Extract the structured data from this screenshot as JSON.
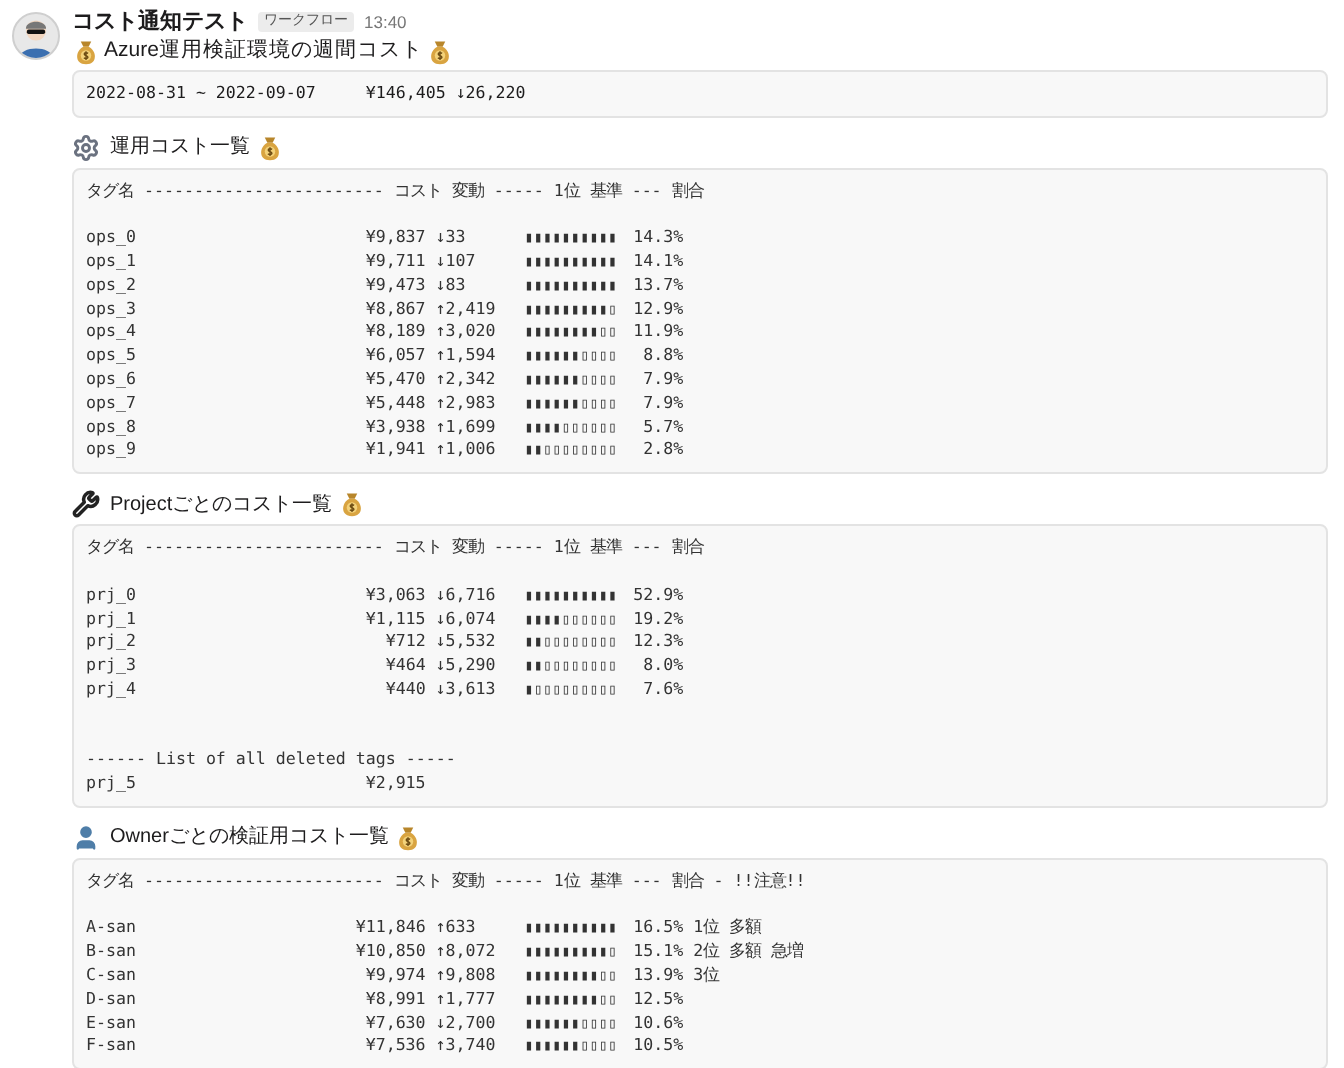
{
  "message": {
    "sender": "コスト通知テスト",
    "badge": "ワークフロー",
    "time": "13:40",
    "title": "Azure運用検証環境の週間コスト"
  },
  "summary": {
    "period": "2022-08-31 ~ 2022-09-07",
    "total": "¥146,405 ↓26,220"
  },
  "sections": [
    {
      "kind": "gear",
      "title": "運用コスト一覧",
      "header": "タグ名 ------------------------ コスト 変動 ----- 1位 基準 --- 割合",
      "rows": [
        {
          "name": "ops_0",
          "cost": "¥9,837",
          "change": "↓33",
          "bar": "▮▮▮▮▮▮▮▮▮▮",
          "share": "14.3%"
        },
        {
          "name": "ops_1",
          "cost": "¥9,711",
          "change": "↓107",
          "bar": "▮▮▮▮▮▮▮▮▮▮",
          "share": "14.1%"
        },
        {
          "name": "ops_2",
          "cost": "¥9,473",
          "change": "↓83",
          "bar": "▮▮▮▮▮▮▮▮▮▮",
          "share": "13.7%"
        },
        {
          "name": "ops_3",
          "cost": "¥8,867",
          "change": "↑2,419",
          "bar": "▮▮▮▮▮▮▮▮▮▯",
          "share": "12.9%"
        },
        {
          "name": "ops_4",
          "cost": "¥8,189",
          "change": "↑3,020",
          "bar": "▮▮▮▮▮▮▮▮▯▯",
          "share": "11.9%"
        },
        {
          "name": "ops_5",
          "cost": "¥6,057",
          "change": "↑1,594",
          "bar": "▮▮▮▮▮▮▯▯▯▯",
          "share": "8.8%"
        },
        {
          "name": "ops_6",
          "cost": "¥5,470",
          "change": "↑2,342",
          "bar": "▮▮▮▮▮▮▯▯▯▯",
          "share": "7.9%"
        },
        {
          "name": "ops_7",
          "cost": "¥5,448",
          "change": "↑2,983",
          "bar": "▮▮▮▮▮▮▯▯▯▯",
          "share": "7.9%"
        },
        {
          "name": "ops_8",
          "cost": "¥3,938",
          "change": "↑1,699",
          "bar": "▮▮▮▮▯▯▯▯▯▯",
          "share": "5.7%"
        },
        {
          "name": "ops_9",
          "cost": "¥1,941",
          "change": "↑1,006",
          "bar": "▮▮▯▯▯▯▯▯▯▯",
          "share": "2.8%"
        }
      ]
    },
    {
      "kind": "wrench",
      "title": "Projectごとのコスト一覧",
      "header": "タグ名 ------------------------ コスト 変動 ----- 1位 基準 --- 割合",
      "rows": [
        {
          "name": "prj_0",
          "cost": "¥3,063",
          "change": "↓6,716",
          "bar": "▮▮▮▮▮▮▮▮▮▮",
          "share": "52.9%"
        },
        {
          "name": "prj_1",
          "cost": "¥1,115",
          "change": "↓6,074",
          "bar": "▮▮▮▮▯▯▯▯▯▯",
          "share": "19.2%"
        },
        {
          "name": "prj_2",
          "cost": "¥712",
          "change": "↓5,532",
          "bar": "▮▮▯▯▯▯▯▯▯▯",
          "share": "12.3%"
        },
        {
          "name": "prj_3",
          "cost": "¥464",
          "change": "↓5,290",
          "bar": "▮▮▯▯▯▯▯▯▯▯",
          "share": "8.0%"
        },
        {
          "name": "prj_4",
          "cost": "¥440",
          "change": "↓3,613",
          "bar": "▮▯▯▯▯▯▯▯▯▯",
          "share": "7.6%"
        }
      ],
      "deleted": {
        "heading": "------ List of all deleted tags -----",
        "rows": [
          {
            "name": "prj_5",
            "cost": "¥2,915"
          }
        ]
      }
    },
    {
      "kind": "person",
      "title": "Ownerごとの検証用コスト一覧",
      "header": "タグ名 ------------------------ コスト 変動 ----- 1位 基準 --- 割合 - !!注意!!",
      "rows": [
        {
          "name": "A-san",
          "cost": "¥11,846",
          "change": "↑633",
          "bar": "▮▮▮▮▮▮▮▮▮▮",
          "share": "16.5%",
          "note": "1位 多額"
        },
        {
          "name": "B-san",
          "cost": "¥10,850",
          "change": "↑8,072",
          "bar": "▮▮▮▮▮▮▮▮▮▯",
          "share": "15.1%",
          "note": "2位 多額 急増"
        },
        {
          "name": "C-san",
          "cost": "¥9,974",
          "change": "↑9,808",
          "bar": "▮▮▮▮▮▮▮▮▯▯",
          "share": "13.9%",
          "note": "3位"
        },
        {
          "name": "D-san",
          "cost": "¥8,991",
          "change": "↑1,777",
          "bar": "▮▮▮▮▮▮▮▮▯▯",
          "share": "12.5%"
        },
        {
          "name": "E-san",
          "cost": "¥7,630",
          "change": "↓2,700",
          "bar": "▮▮▮▮▮▮▯▯▯▯",
          "share": "10.6%"
        },
        {
          "name": "F-san",
          "cost": "¥7,536",
          "change": "↑3,740",
          "bar": "▮▮▮▮▮▮▯▯▯▯",
          "share": "10.5%"
        }
      ]
    }
  ]
}
